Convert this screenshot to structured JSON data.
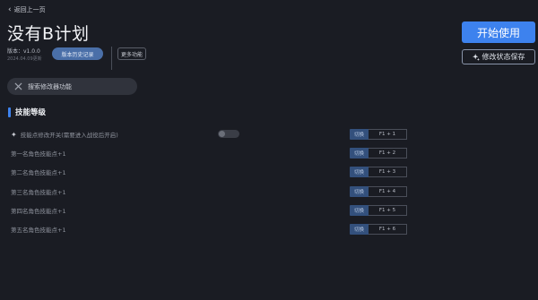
{
  "header": {
    "back_label": "返回上一页",
    "title": "没有B计划",
    "version": "版本：v1.0.0",
    "date": "2024.04.09更新",
    "history_button": "版本历史记录",
    "more_button": "更多功能"
  },
  "actions": {
    "start_label": "开始使用",
    "save_label": "修改状态保存"
  },
  "search": {
    "placeholder": "搜索修改器功能"
  },
  "section": {
    "title": "技能等级"
  },
  "rows": [
    {
      "label": "技能点修改开关(需要进入战役后开启)",
      "switch_label": "切换",
      "hotkey": "F1 + 1"
    },
    {
      "label": "第一名角色技能点+1",
      "switch_label": "切换",
      "hotkey": "F1 + 2"
    },
    {
      "label": "第二名角色技能点+1",
      "switch_label": "切换",
      "hotkey": "F1 + 3"
    },
    {
      "label": "第三名角色技能点+1",
      "switch_label": "切换",
      "hotkey": "F1 + 4"
    },
    {
      "label": "第四名角色技能点+1",
      "switch_label": "切换",
      "hotkey": "F1 + 5"
    },
    {
      "label": "第五名角色技能点+1",
      "switch_label": "切换",
      "hotkey": "F1 + 6"
    }
  ],
  "toggle": {
    "enabled": false
  },
  "icons": {
    "back": "chevron-left-icon",
    "save": "sparkle-icon",
    "search": "tools-icon",
    "row0": "sparkle-icon"
  },
  "colors": {
    "accent": "#3d82ee",
    "history_button_bg": "#4a6fa8",
    "switch_bg": "#33507c",
    "background": "#1a1c23"
  }
}
